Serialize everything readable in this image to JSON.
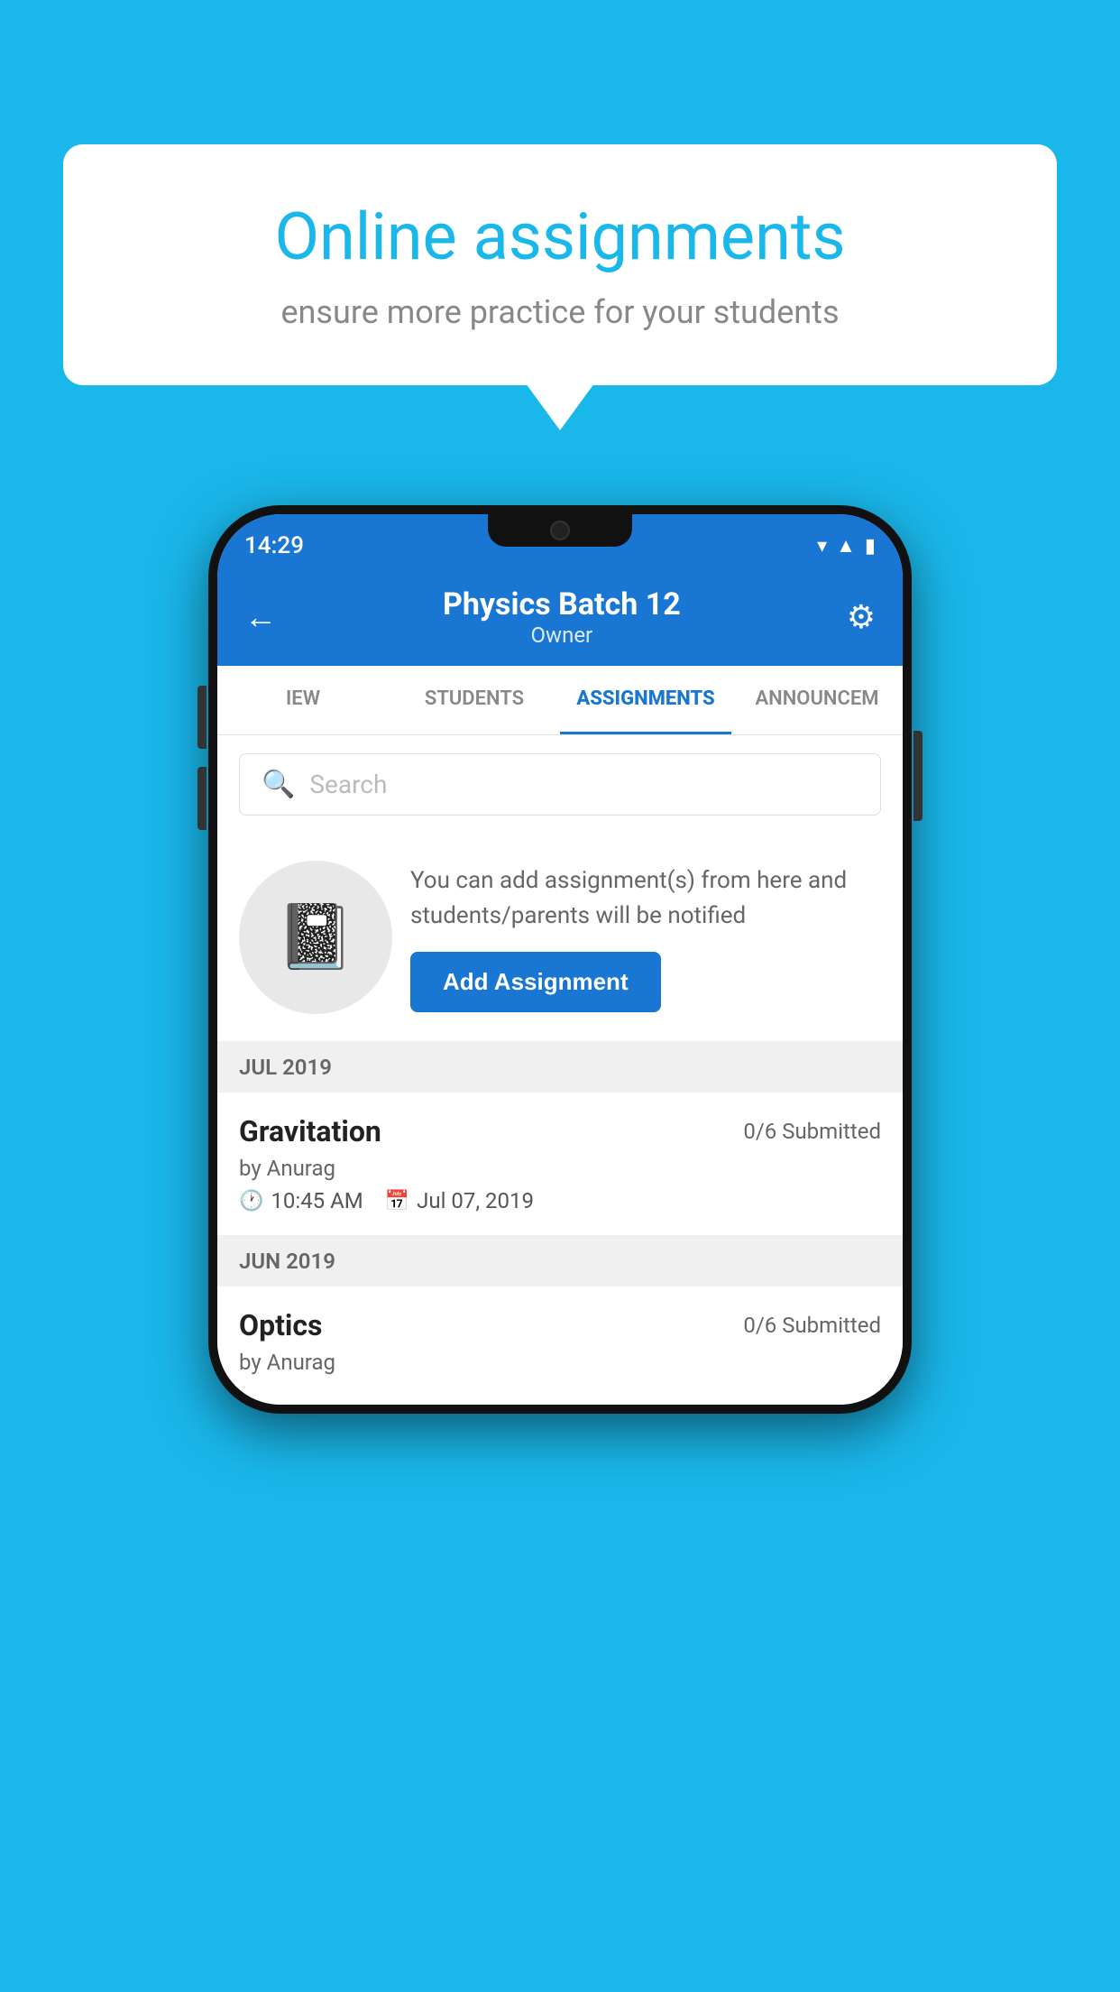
{
  "background": {
    "color": "#1ab7ea"
  },
  "speech_bubble": {
    "title": "Online assignments",
    "subtitle": "ensure more practice for your students"
  },
  "phone": {
    "status_bar": {
      "time": "14:29",
      "icons": [
        "wifi",
        "signal",
        "battery"
      ]
    },
    "header": {
      "title": "Physics Batch 12",
      "subtitle": "Owner",
      "back_label": "←",
      "settings_label": "⚙"
    },
    "tabs": [
      {
        "label": "IEW",
        "active": false
      },
      {
        "label": "STUDENTS",
        "active": false
      },
      {
        "label": "ASSIGNMENTS",
        "active": true
      },
      {
        "label": "ANNOUNCEM",
        "active": false
      }
    ],
    "search": {
      "placeholder": "Search"
    },
    "promo": {
      "description": "You can add assignment(s) from here and students/parents will be notified",
      "button_label": "Add Assignment"
    },
    "sections": [
      {
        "header": "JUL 2019",
        "assignments": [
          {
            "name": "Gravitation",
            "submitted": "0/6 Submitted",
            "author": "by Anurag",
            "time": "10:45 AM",
            "date": "Jul 07, 2019"
          }
        ]
      },
      {
        "header": "JUN 2019",
        "assignments": [
          {
            "name": "Optics",
            "submitted": "0/6 Submitted",
            "author": "by Anurag",
            "time": "",
            "date": ""
          }
        ]
      }
    ]
  }
}
